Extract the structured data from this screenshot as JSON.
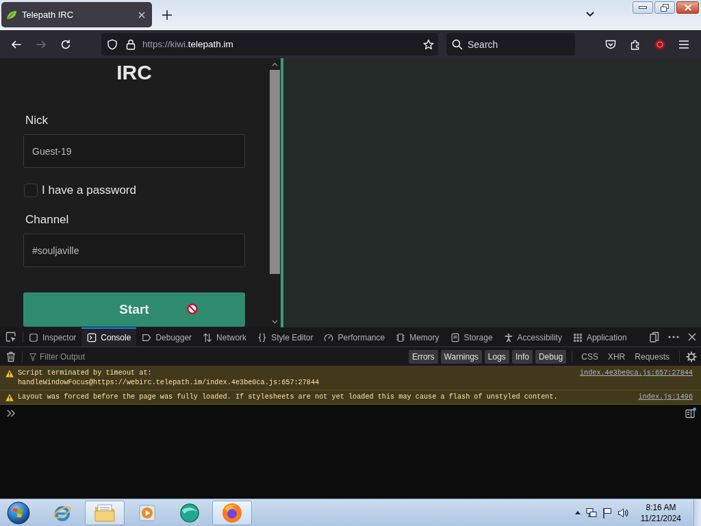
{
  "browser": {
    "tabs": [
      {
        "title": "Telepath IRC",
        "selected": true
      }
    ],
    "nav": {
      "back_disabled": false,
      "forward_disabled": true
    },
    "address": {
      "prefix": "https://kiwi.",
      "host": "telepath.im"
    },
    "search": {
      "placeholder": "Search"
    }
  },
  "page": {
    "heading": "IRC",
    "fields": [
      {
        "kind": "text",
        "label": "Nick",
        "value": "Guest-19"
      },
      {
        "kind": "checkbox",
        "label": "I have a password",
        "checked": false
      },
      {
        "kind": "text",
        "label": "Channel",
        "value": "#souljaville"
      }
    ],
    "submit": "Start"
  },
  "devtools": {
    "tabs": [
      {
        "kind": "inspector",
        "label": "Inspector",
        "selected": false
      },
      {
        "kind": "console",
        "label": "Console",
        "selected": true
      },
      {
        "kind": "debugger",
        "label": "Debugger",
        "selected": false
      },
      {
        "kind": "network",
        "label": "Network",
        "selected": false
      },
      {
        "kind": "style",
        "label": "Style Editor",
        "selected": false
      },
      {
        "kind": "performance",
        "label": "Performance",
        "selected": false
      },
      {
        "kind": "memory",
        "label": "Memory",
        "selected": false
      },
      {
        "kind": "storage",
        "label": "Storage",
        "selected": false
      },
      {
        "kind": "accessibility",
        "label": "Accessibility",
        "selected": false
      },
      {
        "kind": "application",
        "label": "Application",
        "selected": false
      }
    ],
    "filter": {
      "placeholder": "Filter Output"
    },
    "level_filters": [
      {
        "label": "Errors",
        "on": true
      },
      {
        "label": "Warnings",
        "on": true
      },
      {
        "label": "Logs",
        "on": true
      },
      {
        "label": "Info",
        "on": true
      },
      {
        "label": "Debug",
        "on": true
      }
    ],
    "type_filters": [
      {
        "label": "CSS",
        "on": false
      },
      {
        "label": "XHR",
        "on": false
      },
      {
        "label": "Requests",
        "on": false
      }
    ],
    "messages": [
      {
        "kind": "warning",
        "text": "Script terminated by timeout at:",
        "detail": "handleWindowFocus@https://webirc.telepath.im/index.4e3be0ca.js:657:27844",
        "source": "index.4e3be0ca.js:657:27844"
      },
      {
        "kind": "warning",
        "text": "Layout was forced before the page was fully loaded. If stylesheets are not yet loaded this may cause a flash of unstyled content.",
        "source": "index.js:1496"
      }
    ]
  },
  "taskbar": {
    "apps": [
      {
        "kind": "ie",
        "running": false
      },
      {
        "kind": "explorer",
        "running": true
      },
      {
        "kind": "media",
        "running": false
      },
      {
        "kind": "sphere",
        "running": false
      },
      {
        "kind": "firefox",
        "running": true
      }
    ],
    "clock": {
      "time": "8:16 AM",
      "date": "11/21/2024"
    }
  }
}
